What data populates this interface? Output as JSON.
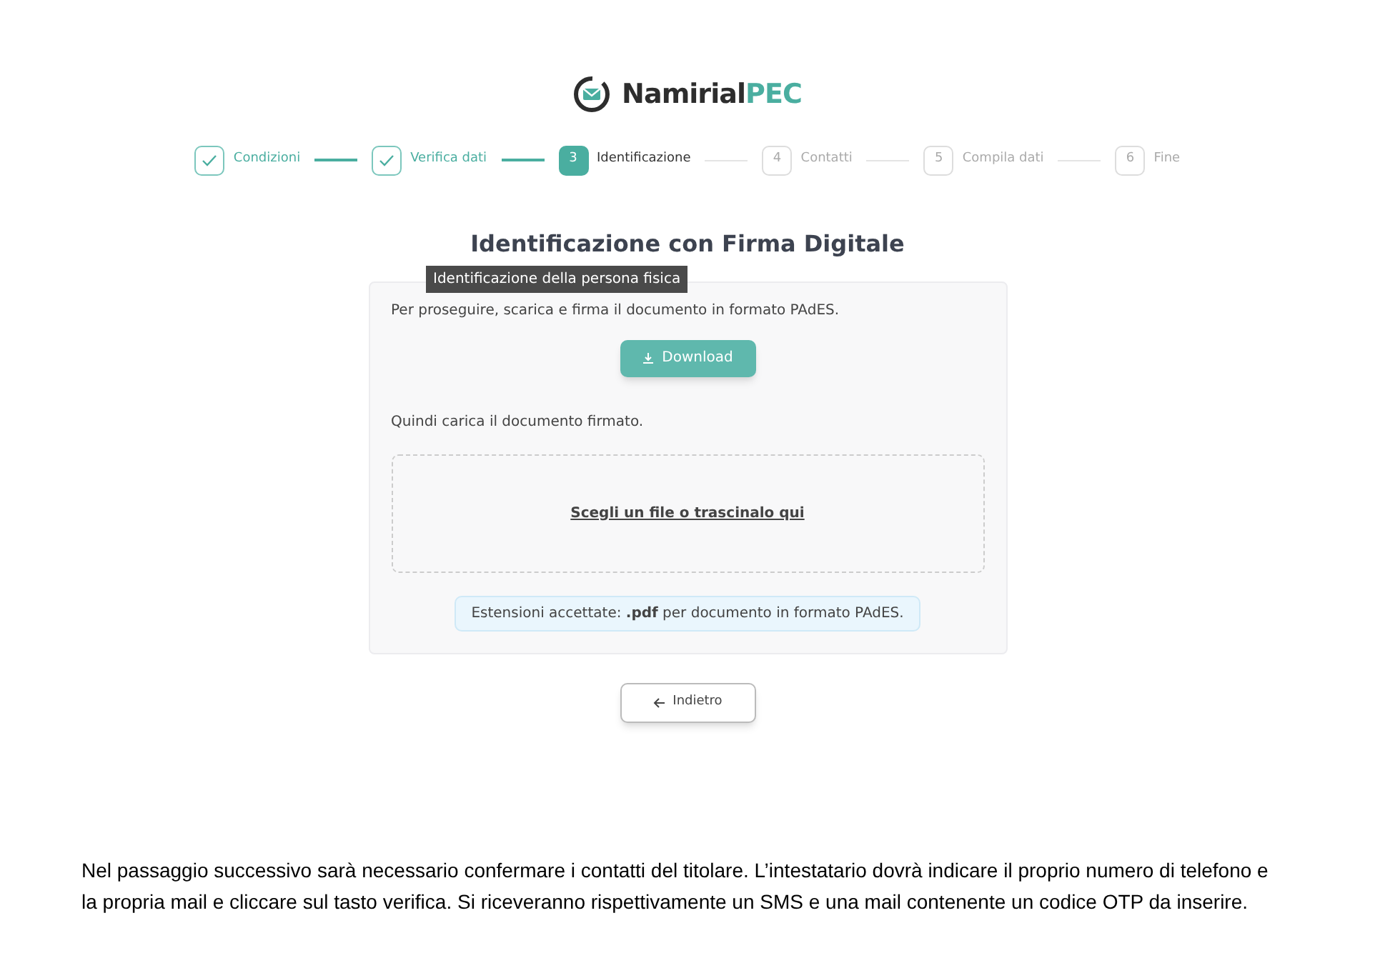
{
  "logo": {
    "name": "Namirial",
    "accent": "PEC"
  },
  "steps": [
    {
      "label": "Condizioni",
      "completed": true,
      "selected": false
    },
    {
      "label": "Verifica dati",
      "completed": true,
      "selected": false
    },
    {
      "number": "3",
      "label": "Identificazione",
      "completed": false,
      "selected": true
    },
    {
      "number": "4",
      "label": "Contatti",
      "completed": false,
      "selected": false
    },
    {
      "number": "5",
      "label": "Compila dati",
      "completed": false,
      "selected": false
    },
    {
      "number": "6",
      "label": "Fine",
      "completed": false,
      "selected": false
    }
  ],
  "title": "Identificazione con Firma Digitale",
  "tooltip": "Identificazione della persona fisica",
  "card": {
    "intro": "Per proseguire, scarica e firma il documento in formato PAdES.",
    "download_button": "Download",
    "upload_intro": "Quindi carica il documento firmato.",
    "dropzone_link": "Scegli un file o trascinalo qui",
    "extensions_note": "Estensioni accettate: **.pdf** per documento in formato PAdES."
  },
  "back_button": "Indietro",
  "caption": "Nel passaggio successivo sarà necessario confermare i contatti del titolare. L’intestatario dovrà indicare il proprio numero di telefono e la propria mail e cliccare sul tasto verifica. Si riceveranno rispettivamente un SMS e una mail contenente un codice OTP da inserire."
}
